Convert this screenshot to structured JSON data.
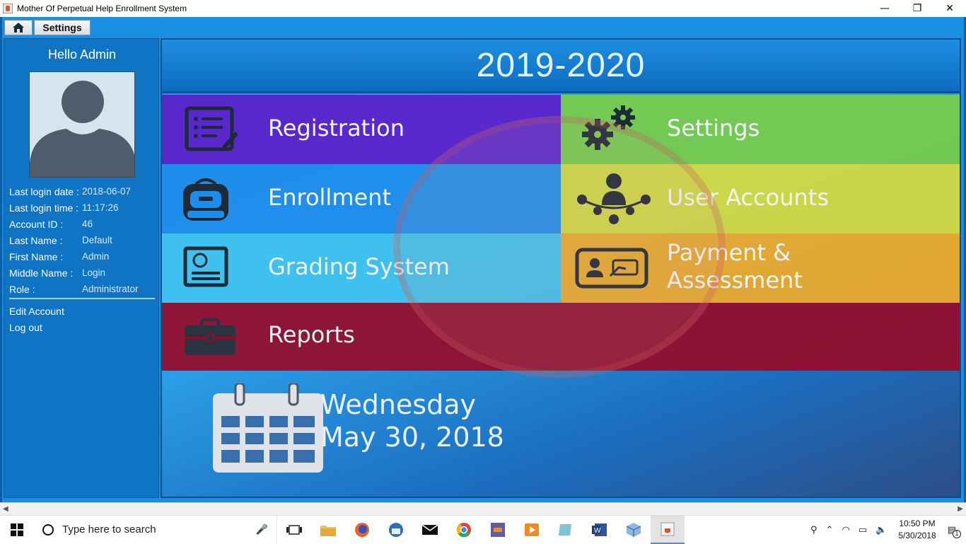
{
  "window": {
    "title": "Mother Of Perpetual Help Enrollment System",
    "controls": [
      "—",
      "❐",
      "✕"
    ]
  },
  "tabs": {
    "home_icon": "home-icon",
    "settings_label": "Settings"
  },
  "sidebar": {
    "greeting": "Hello Admin",
    "fields": [
      {
        "label": "Last login date :",
        "value": "2018-06-07"
      },
      {
        "label": "Last login time :",
        "value": "11:17:26"
      },
      {
        "label": "Account ID :",
        "value": "46"
      },
      {
        "label": "Last Name :",
        "value": "Default"
      },
      {
        "label": "First Name :",
        "value": "Admin"
      },
      {
        "label": "Middle Name :",
        "value": "Login"
      },
      {
        "label": "Role :",
        "value": "Administrator"
      }
    ],
    "edit_account": "Edit Account",
    "logout": "Log out"
  },
  "main": {
    "school_year": "2019-2020",
    "tiles": {
      "registration": "Registration",
      "settings": "Settings",
      "enrollment": "Enrollment",
      "user_accounts": "User Accounts",
      "grading": "Grading System",
      "payment_line1": "Payment &",
      "payment_line2": "Assessment",
      "reports": "Reports"
    },
    "date": {
      "day": "Wednesday",
      "full": "May 30, 2018"
    },
    "colors": {
      "registration": "#6214c8",
      "settings": "#78cd46",
      "enrollment": "#1e8ceb",
      "user_accounts": "#d7dc3c",
      "grading": "#41c3f0",
      "payment": "#f0aa28",
      "reports": "#960a28"
    }
  },
  "taskbar": {
    "search_placeholder": "Type here to search",
    "time": "10:50 PM",
    "date": "5/30/2018",
    "notification_count": "1"
  }
}
